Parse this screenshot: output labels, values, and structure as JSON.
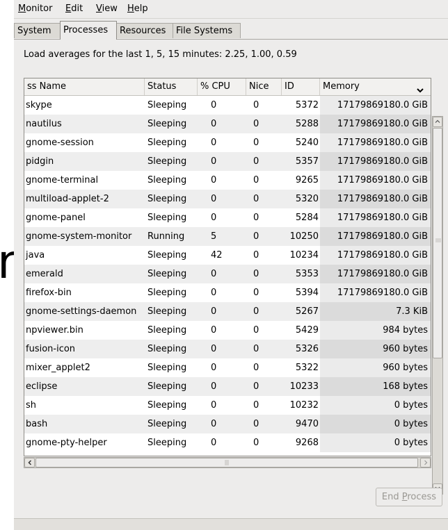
{
  "menu": {
    "items": [
      {
        "mnemonic": "M",
        "rest": "onitor"
      },
      {
        "mnemonic": "E",
        "rest": "dit"
      },
      {
        "mnemonic": "V",
        "rest": "iew"
      },
      {
        "mnemonic": "H",
        "rest": "elp"
      }
    ]
  },
  "tabs": [
    "System",
    "Processes",
    "Resources",
    "File Systems"
  ],
  "active_tab": "Processes",
  "load_averages": "Load averages for the last 1, 5, 15 minutes: 2.25, 1.00, 0.59",
  "stray_glyph": "n",
  "table": {
    "columns": [
      "ss Name",
      "Status",
      "% CPU",
      "Nice",
      "ID",
      "Memory"
    ],
    "sort_indicator": "⌄",
    "rows": [
      {
        "name": "skype",
        "status": "Sleeping",
        "cpu": "0",
        "nice": "0",
        "id": "5372",
        "memory": "17179869180.0 GiB"
      },
      {
        "name": "nautilus",
        "status": "Sleeping",
        "cpu": "0",
        "nice": "0",
        "id": "5288",
        "memory": "17179869180.0 GiB"
      },
      {
        "name": "gnome-session",
        "status": "Sleeping",
        "cpu": "0",
        "nice": "0",
        "id": "5240",
        "memory": "17179869180.0 GiB"
      },
      {
        "name": "pidgin",
        "status": "Sleeping",
        "cpu": "0",
        "nice": "0",
        "id": "5357",
        "memory": "17179869180.0 GiB"
      },
      {
        "name": "gnome-terminal",
        "status": "Sleeping",
        "cpu": "0",
        "nice": "0",
        "id": "9265",
        "memory": "17179869180.0 GiB"
      },
      {
        "name": "multiload-applet-2",
        "status": "Sleeping",
        "cpu": "0",
        "nice": "0",
        "id": "5320",
        "memory": "17179869180.0 GiB"
      },
      {
        "name": "gnome-panel",
        "status": "Sleeping",
        "cpu": "0",
        "nice": "0",
        "id": "5284",
        "memory": "17179869180.0 GiB"
      },
      {
        "name": "gnome-system-monitor",
        "status": "Running",
        "cpu": "5",
        "nice": "0",
        "id": "10250",
        "memory": "17179869180.0 GiB"
      },
      {
        "name": "java",
        "status": "Sleeping",
        "cpu": "42",
        "nice": "0",
        "id": "10234",
        "memory": "17179869180.0 GiB"
      },
      {
        "name": "emerald",
        "status": "Sleeping",
        "cpu": "0",
        "nice": "0",
        "id": "5353",
        "memory": "17179869180.0 GiB"
      },
      {
        "name": "firefox-bin",
        "status": "Sleeping",
        "cpu": "0",
        "nice": "0",
        "id": "5394",
        "memory": "17179869180.0 GiB"
      },
      {
        "name": "gnome-settings-daemon",
        "status": "Sleeping",
        "cpu": "0",
        "nice": "0",
        "id": "5267",
        "memory": "7.3 KiB"
      },
      {
        "name": "npviewer.bin",
        "status": "Sleeping",
        "cpu": "0",
        "nice": "0",
        "id": "5429",
        "memory": "984 bytes"
      },
      {
        "name": "fusion-icon",
        "status": "Sleeping",
        "cpu": "0",
        "nice": "0",
        "id": "5326",
        "memory": "960 bytes"
      },
      {
        "name": "mixer_applet2",
        "status": "Sleeping",
        "cpu": "0",
        "nice": "0",
        "id": "5322",
        "memory": "960 bytes"
      },
      {
        "name": "eclipse",
        "status": "Sleeping",
        "cpu": "0",
        "nice": "0",
        "id": "10233",
        "memory": "168 bytes"
      },
      {
        "name": "sh",
        "status": "Sleeping",
        "cpu": "0",
        "nice": "0",
        "id": "10232",
        "memory": "0 bytes"
      },
      {
        "name": "bash",
        "status": "Sleeping",
        "cpu": "0",
        "nice": "0",
        "id": "9470",
        "memory": "0 bytes"
      },
      {
        "name": "gnome-pty-helper",
        "status": "Sleeping",
        "cpu": "0",
        "nice": "0",
        "id": "9268",
        "memory": "0 bytes"
      }
    ]
  },
  "end_process": {
    "mnemonic_before": "End ",
    "mnemonic": "P",
    "mnemonic_after": "rocess",
    "enabled": false
  },
  "icons": {
    "sort": "chevron-down-icon",
    "scroll_up": "scroll-up-arrow-icon",
    "scroll_down": "scroll-down-arrow-icon",
    "scroll_left": "scroll-left-arrow-icon",
    "scroll_right": "scroll-right-arrow-icon",
    "grip": "scrollbar-grip-icon"
  }
}
